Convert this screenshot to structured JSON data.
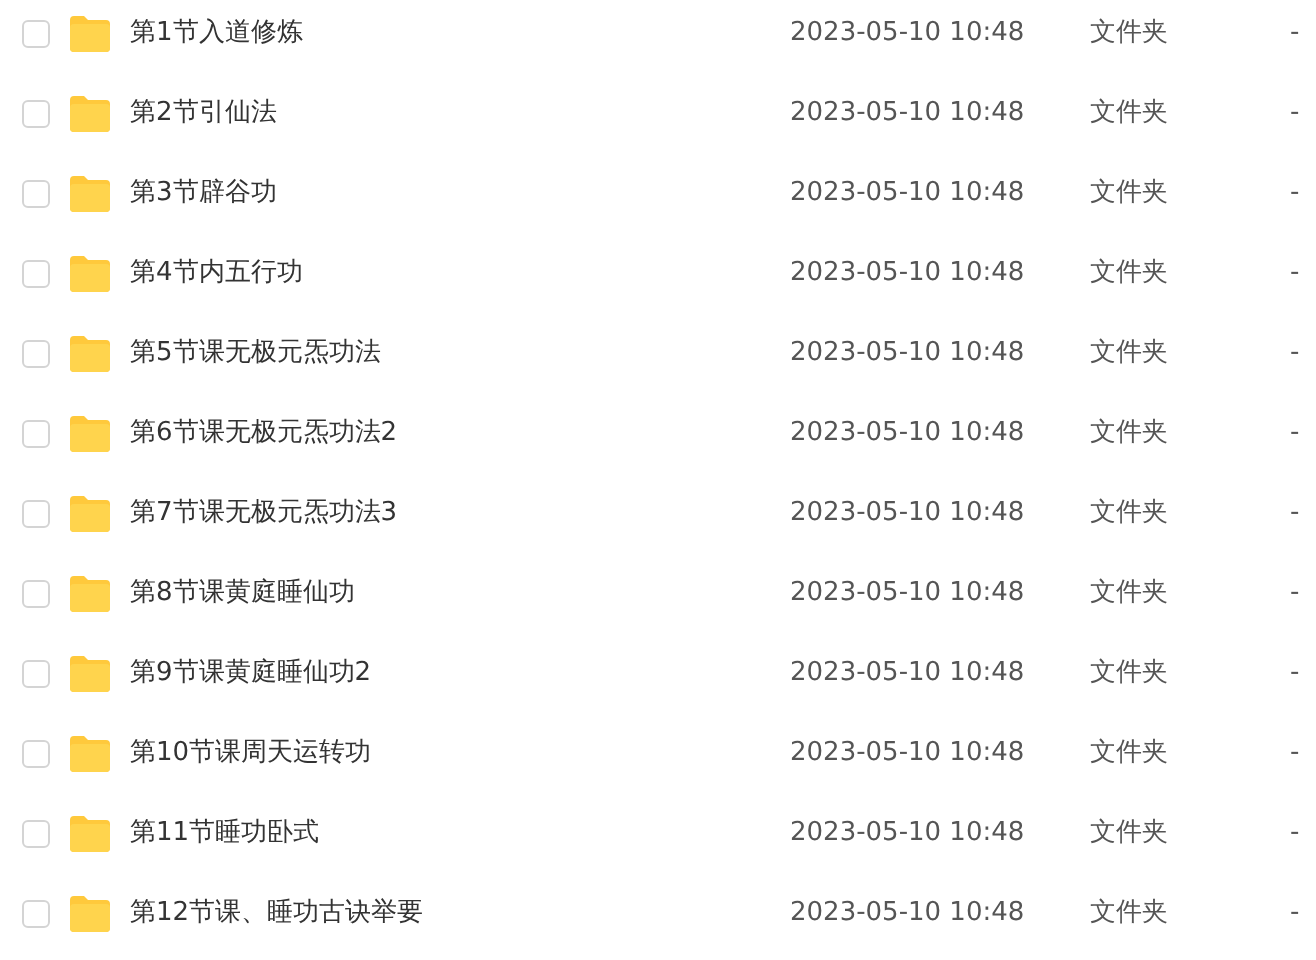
{
  "files": [
    {
      "name": "第1节入道修炼",
      "modified": "2023-05-10 10:48",
      "type": "文件夹",
      "size": "-",
      "checked": false
    },
    {
      "name": "第2节引仙法",
      "modified": "2023-05-10 10:48",
      "type": "文件夹",
      "size": "-",
      "checked": false
    },
    {
      "name": "第3节辟谷功",
      "modified": "2023-05-10 10:48",
      "type": "文件夹",
      "size": "-",
      "checked": false
    },
    {
      "name": "第4节内五行功",
      "modified": "2023-05-10 10:48",
      "type": "文件夹",
      "size": "-",
      "checked": false
    },
    {
      "name": "第5节课无极元炁功法",
      "modified": "2023-05-10 10:48",
      "type": "文件夹",
      "size": "-",
      "checked": false
    },
    {
      "name": "第6节课无极元炁功法2",
      "modified": "2023-05-10 10:48",
      "type": "文件夹",
      "size": "-",
      "checked": false
    },
    {
      "name": "第7节课无极元炁功法3",
      "modified": "2023-05-10 10:48",
      "type": "文件夹",
      "size": "-",
      "checked": false
    },
    {
      "name": "第8节课黄庭睡仙功",
      "modified": "2023-05-10 10:48",
      "type": "文件夹",
      "size": "-",
      "checked": false
    },
    {
      "name": "第9节课黄庭睡仙功2",
      "modified": "2023-05-10 10:48",
      "type": "文件夹",
      "size": "-",
      "checked": false
    },
    {
      "name": "第10节课周天运转功",
      "modified": "2023-05-10 10:48",
      "type": "文件夹",
      "size": "-",
      "checked": false
    },
    {
      "name": "第11节睡功卧式",
      "modified": "2023-05-10 10:48",
      "type": "文件夹",
      "size": "-",
      "checked": false
    },
    {
      "name": "第12节课、睡功古诀举要",
      "modified": "2023-05-10 10:48",
      "type": "文件夹",
      "size": "-",
      "checked": false
    }
  ]
}
